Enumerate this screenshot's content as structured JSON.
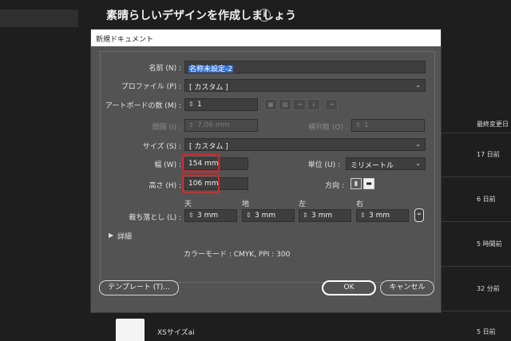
{
  "background": {
    "title": "素晴らしいデザインを作成しましょう",
    "info_icon": "i",
    "column_header": "最終変更日",
    "times": [
      "17 日前",
      "6 日前",
      "5 時間前",
      "32 分前",
      "5 日前"
    ],
    "file_name": "XSサイズai"
  },
  "dialog": {
    "title": "新規ドキュメント",
    "name_label": "名前 (N) :",
    "name_value": "名称未設定-2",
    "profile_label": "プロファイル (P) :",
    "profile_value": "[ カスタム ]",
    "artboard_label": "アートボードの数 (M) :",
    "artboard_value": "1",
    "spacing_label": "間隔 (I) :",
    "spacing_value": "7.06 mm",
    "columns_label": "横列数 (O) :",
    "columns_value": "1",
    "size_label": "サイズ (S) :",
    "size_value": "[ カスタム ]",
    "width_label": "幅 (W) :",
    "width_value": "154 mm",
    "units_label": "単位 (U) :",
    "units_value": "ミリメートル",
    "height_label": "高さ (H) :",
    "height_value": "106 mm",
    "orientation_label": "方向 :",
    "bleed_label": "裁ち落とし (L) :",
    "bleed_heads": [
      "天",
      "地",
      "左",
      "右"
    ],
    "bleed_values": [
      "3 mm",
      "3 mm",
      "3 mm",
      "3 mm"
    ],
    "details_label": "詳細",
    "color_mode": "カラーモード : CMYK, PPI : 300",
    "template_button": "テンプレート (T)...",
    "ok_button": "OK",
    "cancel_button": "キャンセル",
    "highlight_color": "#d8262b"
  }
}
